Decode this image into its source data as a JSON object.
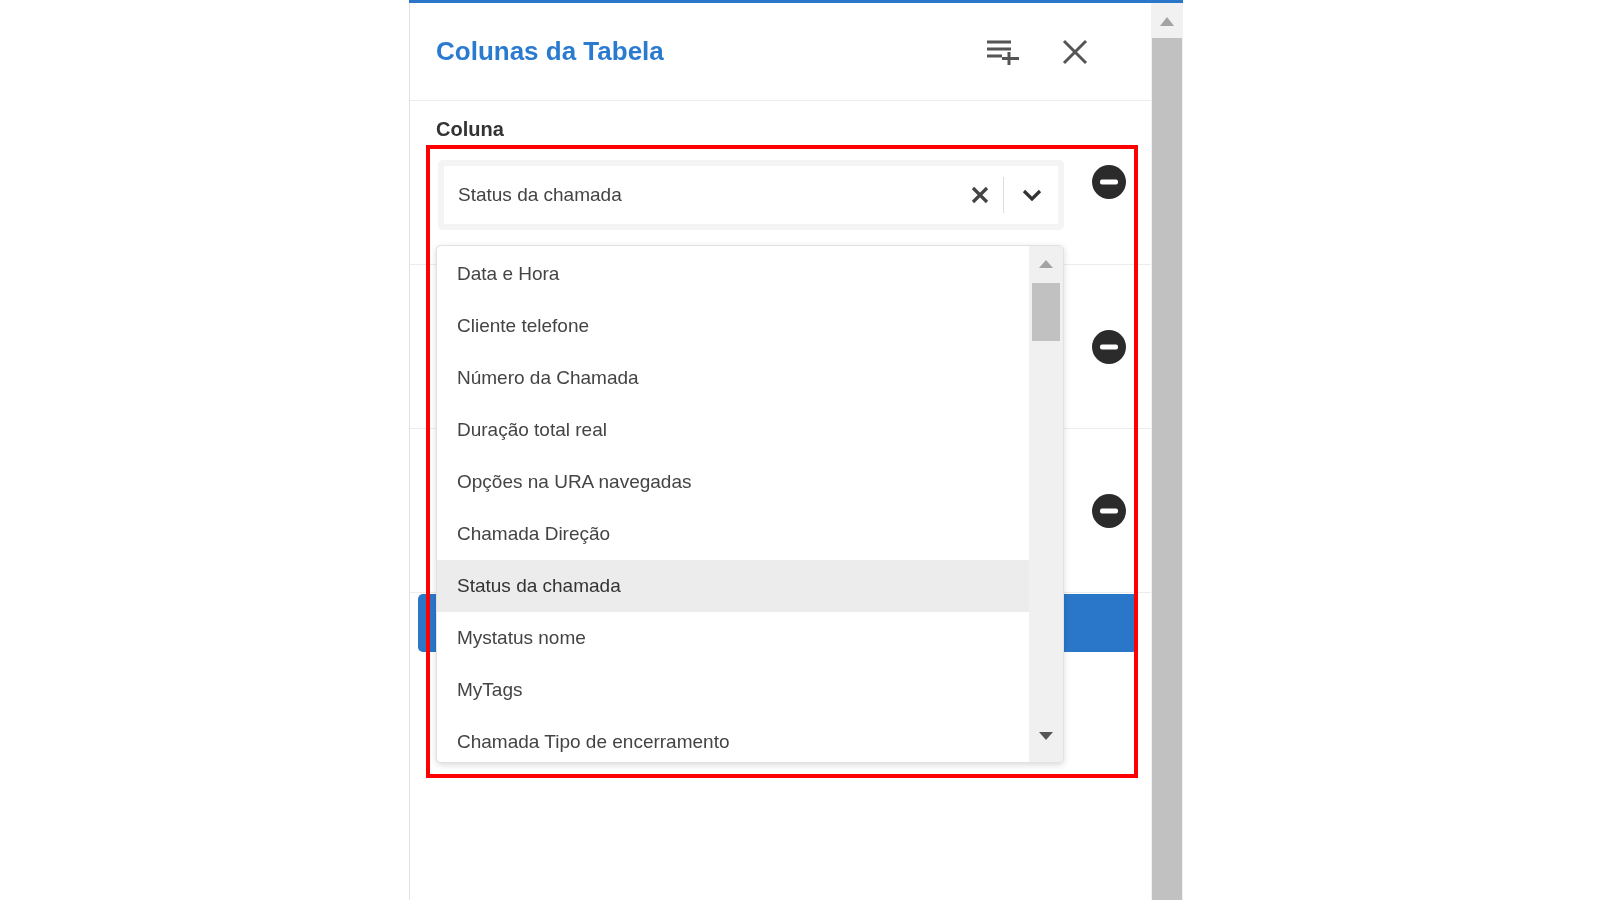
{
  "panel": {
    "title": "Colunas da Tabela"
  },
  "rows": [
    {
      "kind": "field",
      "label": "Coluna",
      "value": "Status da chamada"
    },
    {
      "kind": "covered"
    },
    {
      "kind": "covered"
    }
  ],
  "dropdown": {
    "options": [
      {
        "label": "Data e Hora",
        "selected": false
      },
      {
        "label": "Cliente telefone",
        "selected": false
      },
      {
        "label": "Número da Chamada",
        "selected": false
      },
      {
        "label": "Duração total real",
        "selected": false
      },
      {
        "label": "Opções na URA navegadas",
        "selected": false
      },
      {
        "label": "Chamada Direção",
        "selected": false
      },
      {
        "label": "Status da chamada",
        "selected": true
      },
      {
        "label": "Mystatus nome",
        "selected": false
      },
      {
        "label": "MyTags",
        "selected": false
      },
      {
        "label": "Chamada Tipo de encerramento",
        "selected": false
      }
    ]
  }
}
